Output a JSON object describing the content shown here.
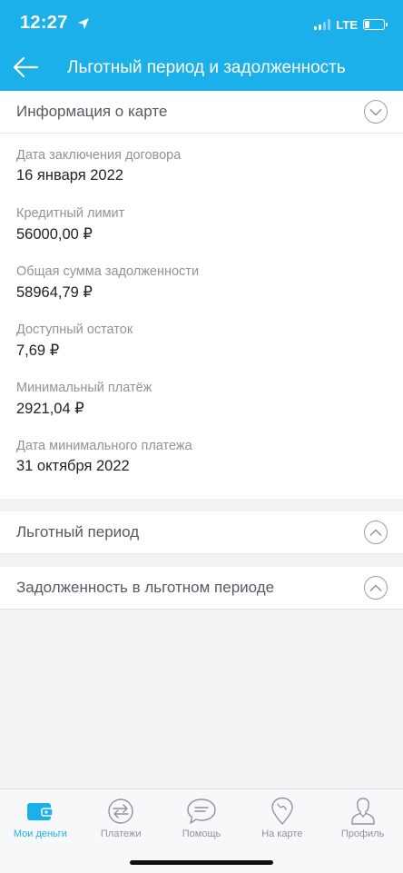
{
  "status_bar": {
    "time": "12:27",
    "network": "LTE"
  },
  "header": {
    "title": "Льготный период и задолженность"
  },
  "sections": [
    {
      "title": "Информация о карте",
      "expanded": true,
      "fields": [
        {
          "label": "Дата заключения договора",
          "value": "16 января 2022"
        },
        {
          "label": "Кредитный лимит",
          "value": "56000,00 ₽"
        },
        {
          "label": "Общая сумма задолженности",
          "value": "58964,79 ₽"
        },
        {
          "label": "Доступный остаток",
          "value": "7,69 ₽"
        },
        {
          "label": "Минимальный платёж",
          "value": "2921,04 ₽"
        },
        {
          "label": "Дата минимального платежа",
          "value": "31 октября 2022"
        }
      ]
    },
    {
      "title": "Льготный период",
      "expanded": false
    },
    {
      "title": "Задолженность в льготном периоде",
      "expanded": false
    }
  ],
  "tabbar": {
    "items": [
      {
        "label": "Мои деньги",
        "icon": "wallet-icon",
        "active": true
      },
      {
        "label": "Платежи",
        "icon": "transfer-arrows-icon",
        "active": false
      },
      {
        "label": "Помощь",
        "icon": "chat-bubble-icon",
        "active": false
      },
      {
        "label": "На карте",
        "icon": "map-pin-icon",
        "active": false
      },
      {
        "label": "Профиль",
        "icon": "profile-icon",
        "active": false
      }
    ]
  },
  "colors": {
    "accent": "#1cb0ea",
    "background": "#f2f3f5",
    "muted_text": "#8e949b"
  }
}
